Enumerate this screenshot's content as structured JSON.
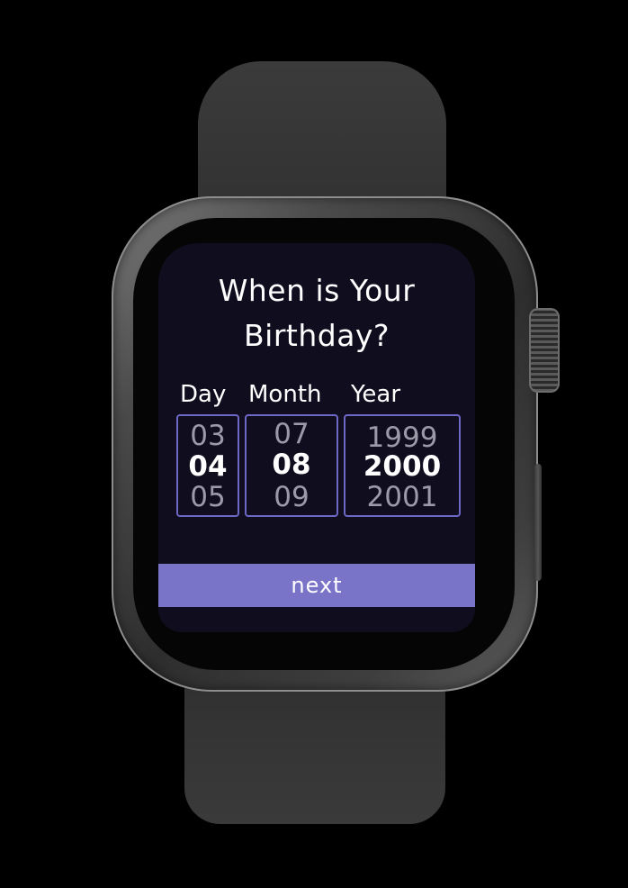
{
  "screen": {
    "title_line1": "When is Your",
    "title_line2": "Birthday?",
    "background": "#100d1f",
    "accent": "#7a74c8"
  },
  "pickers": {
    "day": {
      "label": "Day",
      "above": "03",
      "selected": "04",
      "below": "05"
    },
    "month": {
      "label": "Month",
      "above": "07",
      "selected": "08",
      "below": "09"
    },
    "year": {
      "label": "Year",
      "above": "1999",
      "selected": "2000",
      "below": "2001"
    }
  },
  "actions": {
    "next_label": "next"
  }
}
